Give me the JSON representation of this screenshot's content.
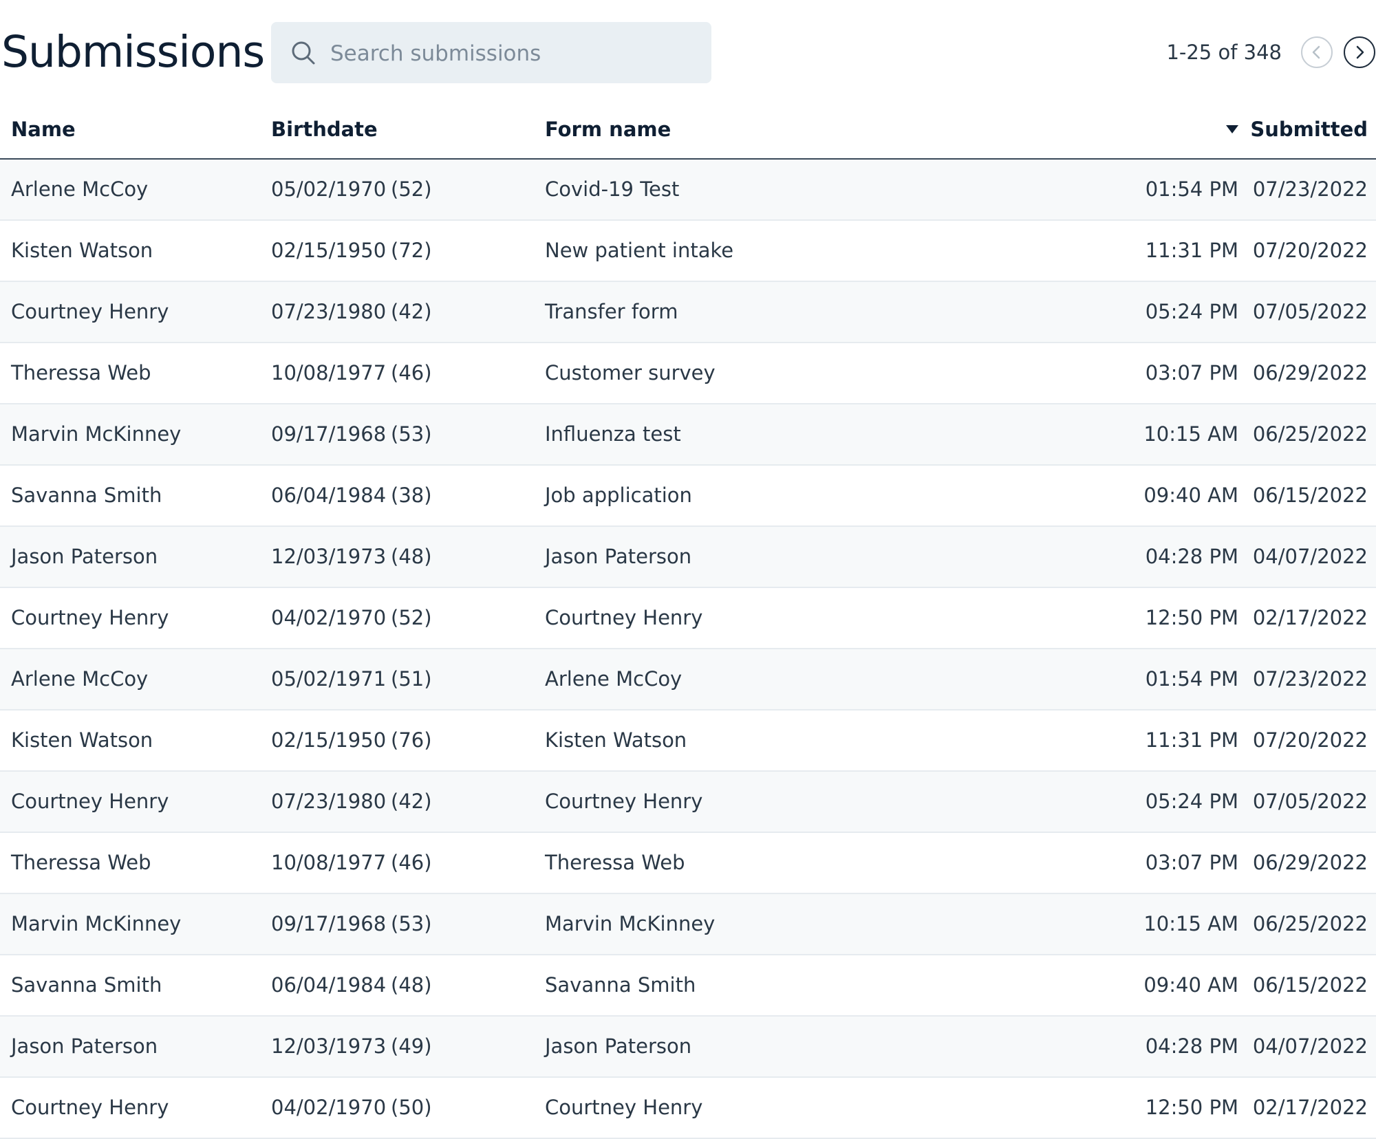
{
  "page": {
    "title": "Submissions"
  },
  "search": {
    "placeholder": "Search submissions",
    "value": ""
  },
  "pagination": {
    "text": "1-25 of 348"
  },
  "table": {
    "columns": {
      "name": "Name",
      "birthdate": "Birthdate",
      "form_name": "Form name",
      "submitted": "Submitted"
    },
    "sort": {
      "column": "submitted",
      "direction": "descending"
    },
    "rows": [
      {
        "name": "Arlene McCoy",
        "birthdate": "05/02/1970",
        "age": "(52)",
        "form": "Covid-19 Test",
        "time": "01:54 PM",
        "date": "07/23/2022"
      },
      {
        "name": "Kisten Watson",
        "birthdate": "02/15/1950",
        "age": "(72)",
        "form": "New patient intake",
        "time": "11:31 PM",
        "date": "07/20/2022"
      },
      {
        "name": "Courtney Henry",
        "birthdate": "07/23/1980",
        "age": "(42)",
        "form": "Transfer form",
        "time": "05:24 PM",
        "date": "07/05/2022"
      },
      {
        "name": "Theressa Web",
        "birthdate": "10/08/1977",
        "age": "(46)",
        "form": "Customer survey",
        "time": "03:07 PM",
        "date": "06/29/2022"
      },
      {
        "name": "Marvin McKinney",
        "birthdate": "09/17/1968",
        "age": "(53)",
        "form": "Influenza test",
        "time": "10:15 AM",
        "date": "06/25/2022"
      },
      {
        "name": "Savanna Smith",
        "birthdate": "06/04/1984",
        "age": "(38)",
        "form": "Job application",
        "time": "09:40 AM",
        "date": "06/15/2022"
      },
      {
        "name": "Jason Paterson",
        "birthdate": "12/03/1973",
        "age": "(48)",
        "form": "Jason Paterson",
        "time": "04:28 PM",
        "date": "04/07/2022"
      },
      {
        "name": "Courtney Henry",
        "birthdate": "04/02/1970",
        "age": "(52)",
        "form": "Courtney Henry",
        "time": "12:50 PM",
        "date": "02/17/2022"
      },
      {
        "name": "Arlene McCoy",
        "birthdate": "05/02/1971",
        "age": "(51)",
        "form": "Arlene McCoy",
        "time": "01:54 PM",
        "date": "07/23/2022"
      },
      {
        "name": "Kisten Watson",
        "birthdate": "02/15/1950",
        "age": "(76)",
        "form": "Kisten Watson",
        "time": "11:31 PM",
        "date": "07/20/2022"
      },
      {
        "name": "Courtney Henry",
        "birthdate": "07/23/1980",
        "age": "(42)",
        "form": "Courtney Henry",
        "time": "05:24 PM",
        "date": "07/05/2022"
      },
      {
        "name": "Theressa Web",
        "birthdate": "10/08/1977",
        "age": "(46)",
        "form": "Theressa Web",
        "time": "03:07 PM",
        "date": "06/29/2022"
      },
      {
        "name": "Marvin McKinney",
        "birthdate": "09/17/1968",
        "age": "(53)",
        "form": "Marvin McKinney",
        "time": "10:15 AM",
        "date": "06/25/2022"
      },
      {
        "name": "Savanna Smith",
        "birthdate": "06/04/1984",
        "age": "(48)",
        "form": "Savanna Smith",
        "time": "09:40 AM",
        "date": "06/15/2022"
      },
      {
        "name": "Jason Paterson",
        "birthdate": "12/03/1973",
        "age": "(49)",
        "form": "Jason Paterson",
        "time": "04:28 PM",
        "date": "04/07/2022"
      },
      {
        "name": "Courtney Henry",
        "birthdate": "04/02/1970",
        "age": "(50)",
        "form": "Courtney Henry",
        "time": "12:50 PM",
        "date": "02/17/2022"
      }
    ]
  },
  "icons": {
    "search": "search-icon",
    "prev": "chevron-left-icon",
    "next": "chevron-right-icon",
    "sort": "sort-descending-icon"
  },
  "colors": {
    "title": "#0f1f33",
    "text": "#2a3846",
    "search_bg": "#e9eff3",
    "row_alt_bg": "#f7f9fa",
    "header_border": "#3a4a5a"
  }
}
